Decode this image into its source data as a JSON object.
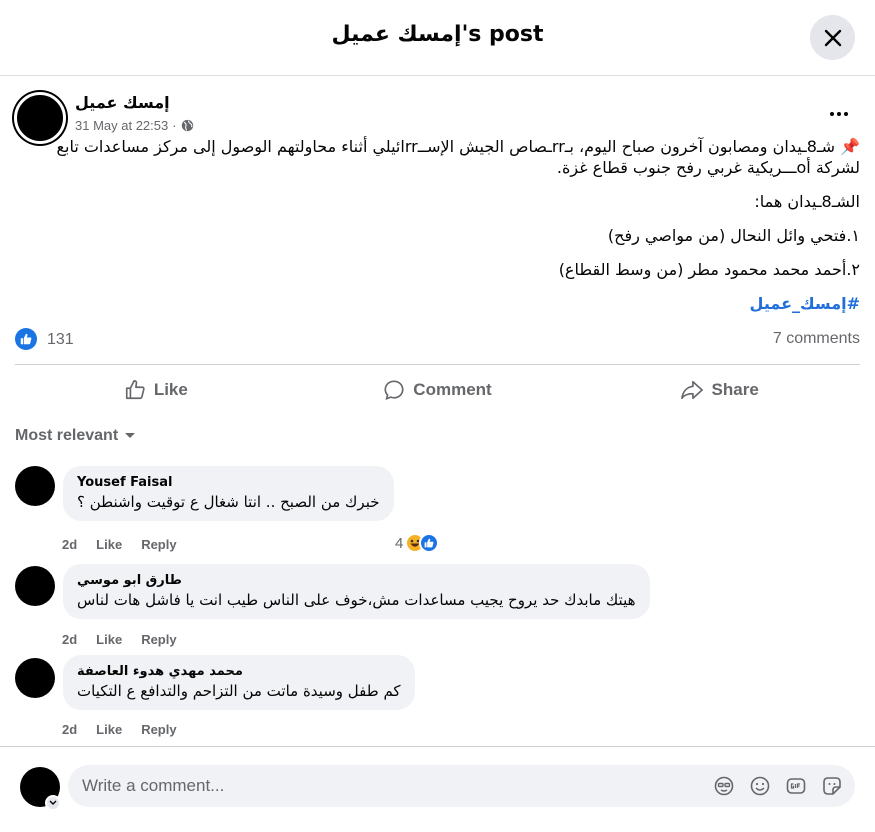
{
  "header": {
    "title": "إمسك عميل's post"
  },
  "post": {
    "author": "إمسك عميل",
    "time": "31 May at 22:53",
    "paragraphs": [
      "📌 شـ8ـيدان ومصابون آخرون صباح اليوم، بـrrـصاص الجيش الإســrrائيلي أثناء محاولتهم الوصول إلى مركز مساعدات تابع لشركة أoـــريكية غربي رفح جنوب قطاع غزة.",
      "الشـ8ـيدان هما:",
      "١.فتحي وائل النحال (من مواصي رفح)",
      "٢.أحمد محمد محمود مطر (من وسط القطاع)"
    ],
    "hashtag": "#إمسك_عميل",
    "like_count": "131",
    "comment_count": "7 comments"
  },
  "actions": {
    "like": "Like",
    "comment": "Comment",
    "share": "Share"
  },
  "sort": {
    "label": "Most relevant"
  },
  "comments": [
    {
      "name": "Yousef Faisal",
      "text": "خبرك من الصبح .. انتا شغال ع توقيت واشنطن ؟",
      "time": "2d",
      "like": "Like",
      "reply": "Reply",
      "reactions": "4"
    },
    {
      "name": "طارق ابو موسي",
      "text": "هيتك مابدك حد يروح يجيب مساعدات مش،خوف على الناس طيب انت يا فاشل هات لناس",
      "time": "2d",
      "like": "Like",
      "reply": "Reply"
    },
    {
      "name": "محمد مهدي هدوء العاصفة",
      "text": "كم طفل وسيدة ماتت من التزاحم والتدافع ع التكيات",
      "time": "2d",
      "like": "Like",
      "reply": "Reply"
    }
  ],
  "composer": {
    "placeholder": "Write a comment..."
  },
  "colors": {
    "accent": "#1b74e4",
    "hashtag": "#216fdb",
    "bubble": "#f0f2f5",
    "muted": "#65676b"
  }
}
